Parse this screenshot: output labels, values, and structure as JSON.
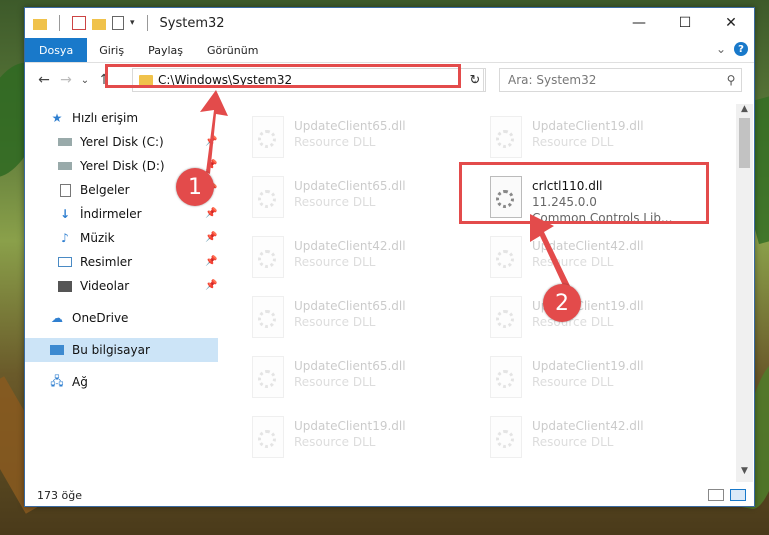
{
  "window": {
    "title": "System32",
    "minimize_glyph": "—",
    "maximize_glyph": "☐",
    "close_glyph": "✕"
  },
  "ribbon": {
    "tabs": [
      "Dosya",
      "Giriş",
      "Paylaş",
      "Görünüm"
    ],
    "expand_glyph": "⌄",
    "help_glyph": "?"
  },
  "navigation": {
    "back_glyph": "←",
    "forward_glyph": "→",
    "recent_glyph": "⌄",
    "up_glyph": "↑",
    "address": "C:\\Windows\\System32",
    "address_dropdown_glyph": "⌄",
    "refresh_glyph": "↻",
    "search_placeholder": "Ara: System32",
    "search_glyph": "⚲"
  },
  "sidebar": {
    "quick_access": "Hızlı erişim",
    "items": [
      {
        "label": "Yerel Disk (C:)",
        "icon": "drive-icon",
        "pinned": true
      },
      {
        "label": "Yerel Disk (D:)",
        "icon": "drive-icon",
        "pinned": true
      },
      {
        "label": "Belgeler",
        "icon": "documents-icon",
        "pinned": true
      },
      {
        "label": "İndirmeler",
        "icon": "downloads-icon",
        "pinned": true
      },
      {
        "label": "Müzik",
        "icon": "music-icon",
        "pinned": true
      },
      {
        "label": "Resimler",
        "icon": "pictures-icon",
        "pinned": true
      },
      {
        "label": "Videolar",
        "icon": "videos-icon",
        "pinned": true
      }
    ],
    "onedrive": "OneDrive",
    "this_pc": "Bu bilgisayar",
    "network": "Ağ"
  },
  "files": {
    "left_column": [
      {
        "name": "UpdateClient65.dll",
        "type": "Resource DLL"
      },
      {
        "name": "UpdateClient65.dll",
        "type": "Resource DLL"
      },
      {
        "name": "UpdateClient42.dll",
        "type": "Resource DLL"
      },
      {
        "name": "UpdateClient65.dll",
        "type": "Resource DLL"
      },
      {
        "name": "UpdateClient65.dll",
        "type": "Resource DLL"
      },
      {
        "name": "UpdateClient19.dll",
        "type": "Resource DLL"
      }
    ],
    "right_column": [
      {
        "name": "UpdateClient19.dll",
        "type": "Resource DLL"
      },
      {
        "name": "UpdateClient42.dll",
        "type": "Resource DLL"
      },
      {
        "name": "UpdateClient19.dll",
        "type": "Resource DLL"
      },
      {
        "name": "UpdateClient19.dll",
        "type": "Resource DLL"
      },
      {
        "name": "UpdateClient42.dll",
        "type": "Resource DLL"
      }
    ],
    "highlighted": {
      "name": "crlctl110.dll",
      "version": "11.245.0.0",
      "description": "Common Controls Lib..."
    }
  },
  "status": {
    "count": "173 öğe"
  },
  "annotations": {
    "step1": "1",
    "step2": "2",
    "color": "#e34b4b"
  }
}
